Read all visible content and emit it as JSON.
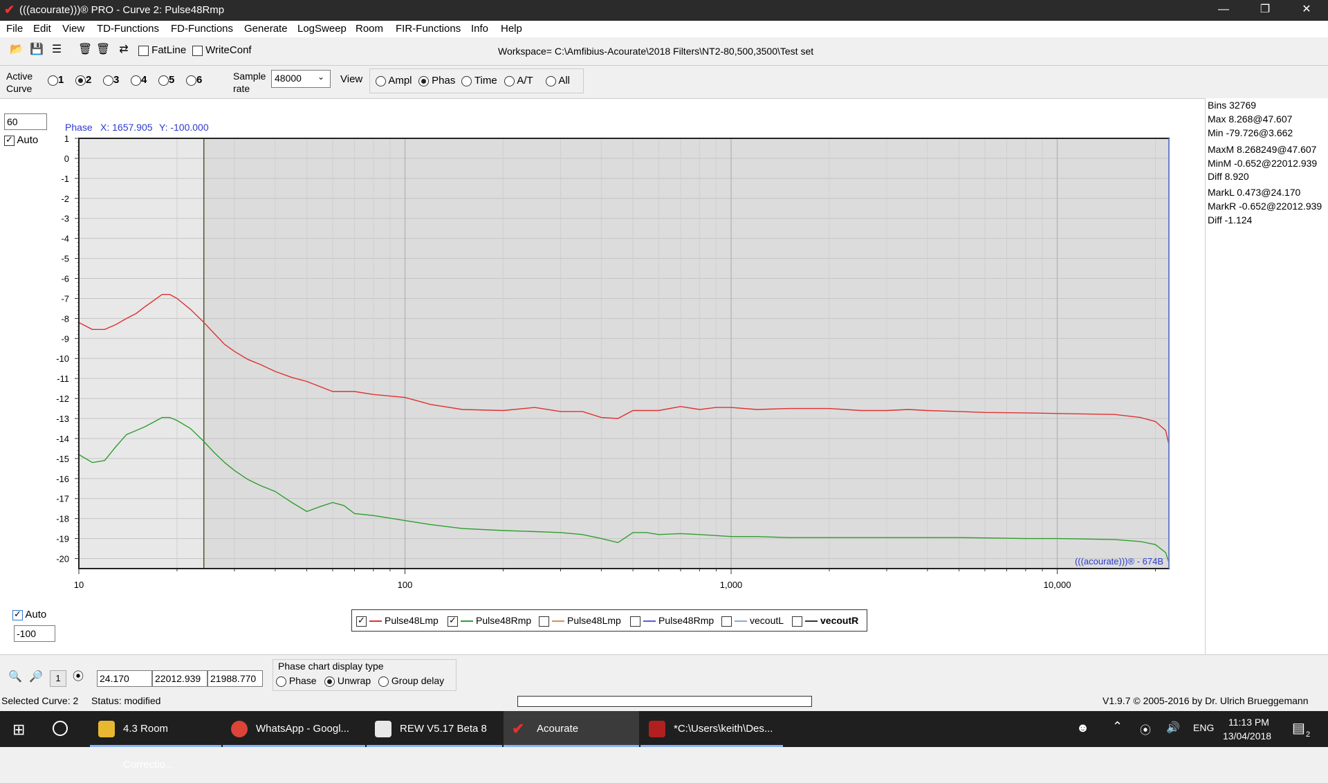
{
  "window": {
    "title": "(((acourate)))® PRO - Curve 2: Pulse48Rmp",
    "min_icon": "minimize-icon",
    "max_icon": "restore-icon",
    "close_icon": "close-icon"
  },
  "menu": [
    "File",
    "Edit",
    "View",
    "TD-Functions",
    "FD-Functions",
    "Generate",
    "LogSweep",
    "Room",
    "FIR-Functions",
    "Info",
    "Help"
  ],
  "toolbar": {
    "fatline_label": "FatLine",
    "writeconf_label": "WriteConf",
    "workspace": "Workspace= C:\\Amfibius-Acourate\\2018 Filters\\NT2-80,500,3500\\Test set"
  },
  "curve_bar": {
    "active_label_1": "Active",
    "active_label_2": "Curve",
    "curves": [
      "1",
      "2",
      "3",
      "4",
      "5",
      "6"
    ],
    "selected_curve": "2",
    "sample_label_1": "Sample",
    "sample_label_2": "rate",
    "sample_rate": "48000",
    "view_label": "View",
    "views": [
      "Ampl",
      "Phas",
      "Time",
      "A/T",
      "All"
    ],
    "selected_view": "Phas"
  },
  "left_panel": {
    "ymax_value": "60",
    "auto_label": "Auto",
    "ymin_value": "-100",
    "auto_bottom_label": "Auto"
  },
  "chart_header": {
    "mode": "Phase",
    "cursor_x": "X: 1657.905",
    "cursor_y": "Y: -100.000"
  },
  "chart_data": {
    "type": "line",
    "xscale": "log",
    "xlim": [
      10,
      22000
    ],
    "ylim": [
      -20.5,
      1.0
    ],
    "ylabel_ticks": [
      "1",
      "0",
      "-1",
      "-2",
      "-3",
      "-4",
      "-5",
      "-6",
      "-7",
      "-8",
      "-9",
      "-10",
      "-11",
      "-12",
      "-13",
      "-14",
      "-15",
      "-16",
      "-17",
      "-18",
      "-19",
      "-20"
    ],
    "xtick_labels": [
      "10",
      "100",
      "1,000",
      "10,000"
    ],
    "marker_x": 24.17,
    "grid": true,
    "watermark": "(((acourate)))® - 674B",
    "series": [
      {
        "name": "Pulse48Lmp",
        "color": "#e03030",
        "x": [
          10,
          11,
          12,
          13,
          14,
          15,
          16,
          18,
          19,
          20,
          22,
          24,
          26,
          28,
          30,
          33,
          36,
          40,
          45,
          50,
          60,
          70,
          80,
          100,
          120,
          150,
          200,
          250,
          300,
          350,
          400,
          450,
          500,
          550,
          600,
          700,
          800,
          900,
          1000,
          1200,
          1500,
          2000,
          2500,
          3000,
          3500,
          4000,
          5000,
          6000,
          8000,
          10000,
          12000,
          15000,
          18000,
          20000,
          21500,
          22000
        ],
        "y": [
          -8.2,
          -8.55,
          -8.55,
          -8.3,
          -8.0,
          -7.75,
          -7.4,
          -6.8,
          -6.8,
          -7.0,
          -7.55,
          -8.15,
          -8.75,
          -9.3,
          -9.65,
          -10.05,
          -10.3,
          -10.65,
          -10.95,
          -11.15,
          -11.65,
          -11.65,
          -11.8,
          -11.95,
          -12.3,
          -12.55,
          -12.6,
          -12.45,
          -12.65,
          -12.65,
          -12.95,
          -13.0,
          -12.6,
          -12.6,
          -12.6,
          -12.4,
          -12.55,
          -12.45,
          -12.45,
          -12.55,
          -12.5,
          -12.5,
          -12.6,
          -12.6,
          -12.55,
          -12.6,
          -12.65,
          -12.7,
          -12.72,
          -12.75,
          -12.77,
          -12.8,
          -12.95,
          -13.15,
          -13.6,
          -14.3
        ]
      },
      {
        "name": "Pulse48Rmp",
        "color": "#2e9e2e",
        "x": [
          10,
          11,
          12,
          13,
          14,
          15,
          16,
          18,
          19,
          20,
          22,
          24,
          26,
          28,
          30,
          33,
          36,
          40,
          45,
          50,
          55,
          60,
          65,
          70,
          80,
          100,
          120,
          150,
          200,
          250,
          300,
          350,
          400,
          450,
          500,
          550,
          600,
          700,
          800,
          900,
          1000,
          1200,
          1500,
          2000,
          2500,
          3000,
          3500,
          4000,
          5000,
          6000,
          8000,
          10000,
          12000,
          15000,
          18000,
          20000,
          21500,
          22000
        ],
        "y": [
          -14.8,
          -15.2,
          -15.1,
          -14.4,
          -13.8,
          -13.6,
          -13.4,
          -12.95,
          -12.95,
          -13.1,
          -13.5,
          -14.1,
          -14.7,
          -15.2,
          -15.6,
          -16.05,
          -16.35,
          -16.65,
          -17.2,
          -17.65,
          -17.4,
          -17.2,
          -17.35,
          -17.75,
          -17.85,
          -18.1,
          -18.3,
          -18.5,
          -18.6,
          -18.65,
          -18.7,
          -18.8,
          -19.0,
          -19.2,
          -18.7,
          -18.7,
          -18.8,
          -18.75,
          -18.8,
          -18.85,
          -18.9,
          -18.9,
          -18.95,
          -18.95,
          -18.95,
          -18.95,
          -18.95,
          -18.95,
          -18.95,
          -18.97,
          -19.0,
          -19.0,
          -19.02,
          -19.05,
          -19.15,
          -19.3,
          -19.7,
          -20.2
        ]
      }
    ]
  },
  "stats": {
    "bins": "Bins 32769",
    "max": "Max 8.268@47.607",
    "min": "Min -79.726@3.662",
    "maxm": "MaxM 8.268249@47.607",
    "minm": "MinM -0.652@22012.939",
    "diff1": "Diff 8.920",
    "markl": "MarkL 0.473@24.170",
    "markr": "MarkR -0.652@22012.939",
    "diff2": "Diff -1.124"
  },
  "legend": [
    {
      "label": "Pulse48Lmp",
      "checked": true,
      "color": "#e03030"
    },
    {
      "label": "Pulse48Rmp",
      "checked": true,
      "color": "#2e9e2e"
    },
    {
      "label": "Pulse48Lmp",
      "checked": false,
      "color": "#e08a50"
    },
    {
      "label": "Pulse48Rmp",
      "checked": false,
      "color": "#5060d8"
    },
    {
      "label": "vecoutL",
      "checked": false,
      "color": "#8aaad0"
    },
    {
      "label": "vecoutR",
      "checked": false,
      "color": "#333333"
    }
  ],
  "bottom_controls": {
    "reset_label": "1",
    "field_1": "24.170",
    "field_2": "22012.939",
    "field_3": "21988.770",
    "phase_type_title": "Phase chart display type",
    "phase_options": [
      "Phase",
      "Unwrap",
      "Group delay"
    ],
    "selected_phase_option": "Unwrap"
  },
  "status": {
    "selected": "Selected Curve: 2",
    "status": "Status: modified",
    "version": "V1.9.7 © 2005-2016 by Dr. Ulrich Brueggemann"
  },
  "taskbar": {
    "tasks": [
      {
        "label": "4.3 Room Correctio...",
        "icon": "folder-icon"
      },
      {
        "label": "WhatsApp - Googl...",
        "icon": "chrome-icon"
      },
      {
        "label": "REW V5.17 Beta 8",
        "icon": "java-icon"
      },
      {
        "label": "Acourate",
        "icon": "acourate-icon"
      },
      {
        "label": "*C:\\Users\\keith\\Des...",
        "icon": "editor-icon"
      }
    ],
    "lang": "ENG",
    "time": "11:13 PM",
    "date": "13/04/2018",
    "notif_count": "2"
  }
}
